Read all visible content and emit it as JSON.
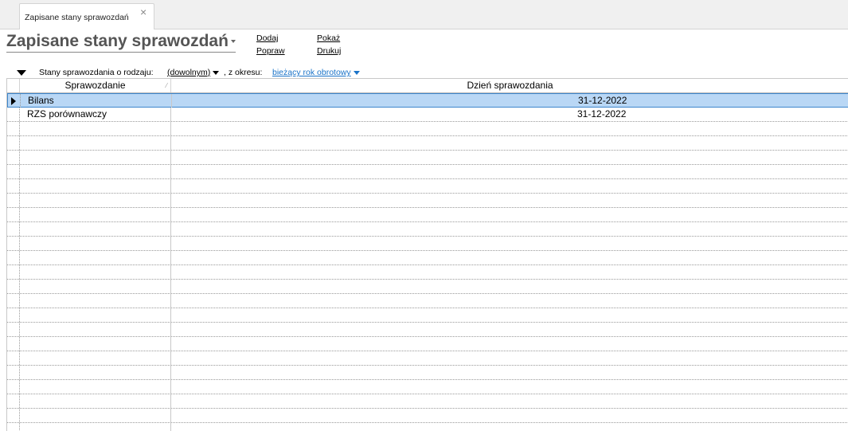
{
  "tab": {
    "label": "Zapisane stany sprawozdań",
    "close": "×"
  },
  "header": {
    "title": "Zapisane stany sprawozdań",
    "actions": {
      "add": "Dodaj",
      "edit": "Popraw",
      "show": "Pokaż",
      "print": "Drukuj"
    }
  },
  "filter": {
    "kind_label": "Stany sprawozdania o rodzaju:",
    "kind_value": "(dowolnym)",
    "period_label": ", z okresu:",
    "period_value": "bieżący rok obrotowy"
  },
  "grid": {
    "columns": [
      "Sprawozdanie",
      "Dzień sprawozdania"
    ],
    "rows": [
      {
        "name": "Bilans",
        "date": "31-12-2022",
        "selected": true
      },
      {
        "name": "RZS porównawczy",
        "date": "31-12-2022",
        "selected": false
      }
    ],
    "sort_indicator": "⁄"
  },
  "colors": {
    "selection": "#b9d7f5",
    "selection_border": "#3d86cc",
    "link_blue": "#1a73c8"
  }
}
